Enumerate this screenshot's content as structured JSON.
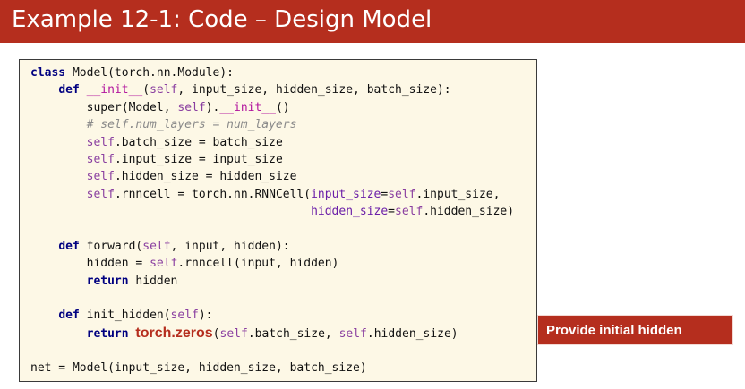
{
  "slide": {
    "title": "Example 12-1: Code – Design Model",
    "callout_text": "Provide initial hidden",
    "accent_color": "#b52e1e",
    "code_background": "#fdf8e6"
  },
  "code": [
    [
      {
        "t": "class",
        "c": "kw"
      },
      {
        "t": " Model(torch.nn.Module):"
      }
    ],
    [
      {
        "t": "    "
      },
      {
        "t": "def",
        "c": "kw"
      },
      {
        "t": " "
      },
      {
        "t": "__init__",
        "c": "dunder"
      },
      {
        "t": "("
      },
      {
        "t": "self",
        "c": "self"
      },
      {
        "t": ", input_size, hidden_size, batch_size):"
      }
    ],
    [
      {
        "t": "        super(Model, "
      },
      {
        "t": "self",
        "c": "self"
      },
      {
        "t": ")."
      },
      {
        "t": "__init__",
        "c": "dunder"
      },
      {
        "t": "()"
      }
    ],
    [
      {
        "t": "        # self.num_layers = num_layers",
        "c": "cm"
      }
    ],
    [
      {
        "t": "        "
      },
      {
        "t": "self",
        "c": "self"
      },
      {
        "t": ".batch_size = batch_size"
      }
    ],
    [
      {
        "t": "        "
      },
      {
        "t": "self",
        "c": "self"
      },
      {
        "t": ".input_size = input_size"
      }
    ],
    [
      {
        "t": "        "
      },
      {
        "t": "self",
        "c": "self"
      },
      {
        "t": ".hidden_size = hidden_size"
      }
    ],
    [
      {
        "t": "        "
      },
      {
        "t": "self",
        "c": "self"
      },
      {
        "t": ".rnncell = torch.nn.RNNCell("
      },
      {
        "t": "input_size",
        "c": "kwarg"
      },
      {
        "t": "="
      },
      {
        "t": "self",
        "c": "self"
      },
      {
        "t": ".input_size,"
      }
    ],
    [
      {
        "t": "                                        "
      },
      {
        "t": "hidden_size",
        "c": "kwarg"
      },
      {
        "t": "="
      },
      {
        "t": "self",
        "c": "self"
      },
      {
        "t": ".hidden_size)"
      }
    ],
    [],
    [
      {
        "t": "    "
      },
      {
        "t": "def",
        "c": "kw"
      },
      {
        "t": " forward("
      },
      {
        "t": "self",
        "c": "self"
      },
      {
        "t": ", input, hidden):"
      }
    ],
    [
      {
        "t": "        hidden = "
      },
      {
        "t": "self",
        "c": "self"
      },
      {
        "t": ".rnncell(input, hidden)"
      }
    ],
    [
      {
        "t": "        "
      },
      {
        "t": "return",
        "c": "kw"
      },
      {
        "t": " hidden"
      }
    ],
    [],
    [
      {
        "t": "    "
      },
      {
        "t": "def",
        "c": "kw"
      },
      {
        "t": " init_hidden("
      },
      {
        "t": "self",
        "c": "self"
      },
      {
        "t": "):"
      }
    ],
    [
      {
        "t": "        "
      },
      {
        "t": "return",
        "c": "kw"
      },
      {
        "t": " "
      },
      {
        "t": "torch.zeros",
        "c": "hl"
      },
      {
        "t": "("
      },
      {
        "t": "self",
        "c": "self"
      },
      {
        "t": ".batch_size, "
      },
      {
        "t": "self",
        "c": "self"
      },
      {
        "t": ".hidden_size)"
      }
    ],
    [],
    [
      {
        "t": "net = Model(input_size, hidden_size, batch_size)"
      }
    ]
  ]
}
